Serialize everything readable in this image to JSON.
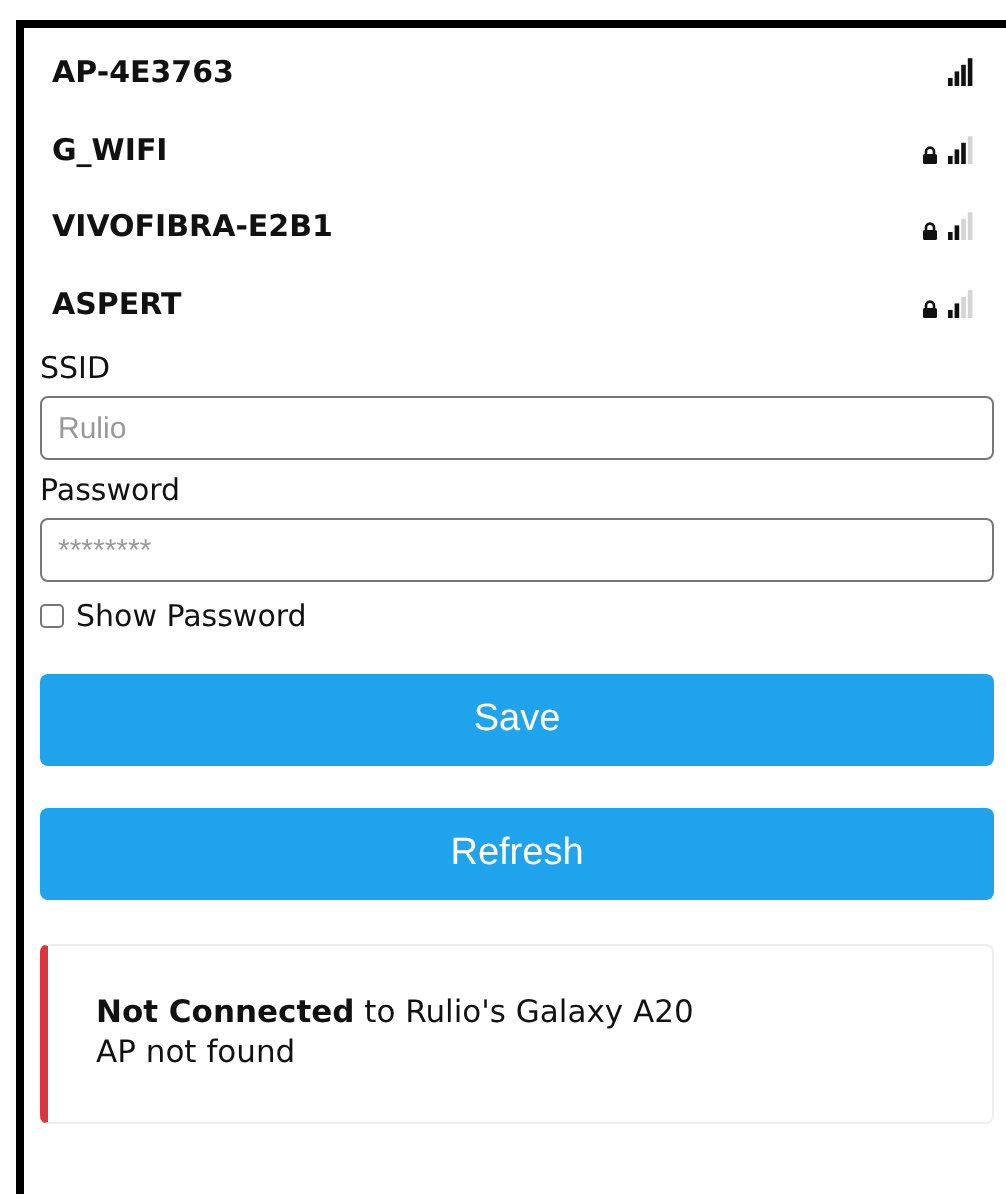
{
  "networks": [
    {
      "name": "AP-4E3763",
      "locked": false,
      "kind": "full"
    },
    {
      "name": "G_WIFI",
      "locked": true,
      "kind": "good"
    },
    {
      "name": "VIVOFIBRA-E2B1",
      "locked": true,
      "kind": "fair"
    },
    {
      "name": "ASPERT",
      "locked": true,
      "kind": "fair"
    }
  ],
  "ssid": {
    "label": "SSID",
    "placeholder": "Rulio"
  },
  "password": {
    "label": "Password",
    "placeholder": "********"
  },
  "show_password": {
    "label": "Show Password",
    "checked": false
  },
  "buttons": [
    "Save",
    "Refresh"
  ],
  "status": {
    "message": "**Not Connected** to Rulio's Galaxy A20",
    "detail": "AP not found"
  }
}
